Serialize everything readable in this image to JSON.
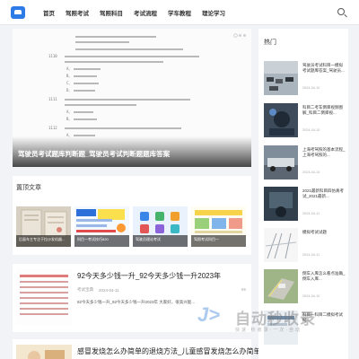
{
  "nav": {
    "items": [
      "首页",
      "驾照考试",
      "驾照科目",
      "考试流程",
      "学车教程",
      "理论学习"
    ]
  },
  "banner": {
    "title": "驾驶员考试题库判断题_驾驶员考试判断题题库答案",
    "exam_lines": {
      "q1": "1110",
      "q2": "1111",
      "q3": "1112",
      "opts": [
        "A、",
        "B、",
        "C、",
        "D、"
      ]
    }
  },
  "featured": {
    "title": "置顶文章",
    "items": [
      {
        "caption": "后面车主专注于拉沙发机器..."
      },
      {
        "caption": "科目一考试技巧520"
      },
      {
        "caption": "驾驶员理论考试"
      },
      {
        "caption": "驾照考试科目一"
      }
    ]
  },
  "articles": [
    {
      "title": "92今天多少钱一升_92今天多少钱一升2023年",
      "category": "考试宝典",
      "date": "2024-04-11",
      "comments": "65",
      "excerpt": "92今天多少钱一升_92今天多少钱一升2023年     大家好，很高兴能..."
    },
    {
      "title": "感冒发烧怎么办简单的退烧方法_儿童感冒发烧怎么办简单的退烧方"
    }
  ],
  "sidebar": {
    "title": "热门",
    "items": [
      {
        "text": "驾驶员考试科目一模拟考试题库答案_驾驶员...",
        "date": "2024-04-10"
      },
      {
        "text": "科目二考车倒库视频图解_科目二倒库视...",
        "date": "2024-04-10"
      },
      {
        "text": "上海考驾照的基本流程_上海考驾照的...",
        "date": "2024-04-10"
      },
      {
        "text": "2021最新科目四仿真考试_2021最新...",
        "date": "2024-04-11"
      },
      {
        "text": "模拟考试试题",
        "date": "2024-04-11"
      },
      {
        "text": "倒车入库怎么看点准确_倒车入库...",
        "date": "2024-04-10"
      },
      {
        "text": "科目一科目二模拟考试网...",
        "date": ""
      }
    ]
  },
  "watermark": {
    "brand": "自动秒收录",
    "sub": "快速·秒收录·一次·自动"
  },
  "colors": {
    "accent": "#2d7be6",
    "background": "#f1f3f6"
  }
}
